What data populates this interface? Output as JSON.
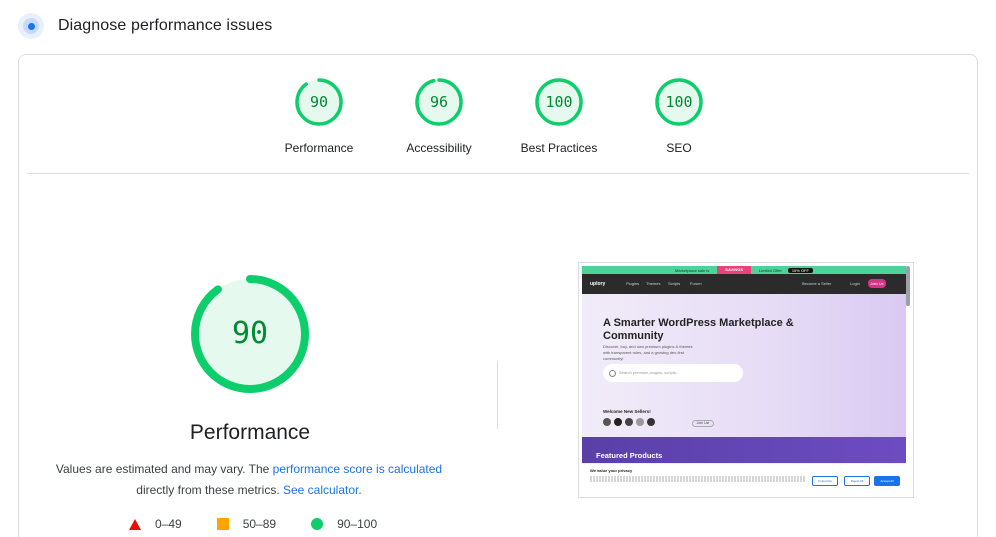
{
  "header": {
    "title": "Diagnose performance issues",
    "icon": "lighthouse-icon"
  },
  "categories": [
    {
      "score": "90",
      "label": "Performance"
    },
    {
      "score": "96",
      "label": "Accessibility"
    },
    {
      "score": "100",
      "label": "Best Practices"
    },
    {
      "score": "100",
      "label": "SEO"
    }
  ],
  "main": {
    "score": "90",
    "title": "Performance",
    "desc_part1": "Values are estimated and may vary. The ",
    "desc_link1": "performance score is calculated",
    "desc_part2": " directly from these metrics. ",
    "desc_link2": "See calculator."
  },
  "legend": [
    {
      "range": "0–49",
      "shape": "triangle",
      "color": "#eb0f00"
    },
    {
      "range": "50–89",
      "shape": "square",
      "color": "#ffa400"
    },
    {
      "range": "90–100",
      "shape": "circle",
      "color": "#0cce6b"
    }
  ],
  "colors": {
    "pass": "#0cce6b",
    "pass_text": "#008a33",
    "pass_fill": "#e6f9ee",
    "link": "#1a73e8"
  },
  "thumbnail": {
    "promo_left": "Marketplace sale is",
    "promo_badge": "SAVINGS",
    "promo_right": "Limited Offer",
    "promo_tag": "15% OFF",
    "brand": "uplory",
    "nav": [
      "Plugins",
      "Themes",
      "Scripts",
      "Forum"
    ],
    "nav_right": "Become a Seller",
    "login": "Login",
    "join": "Join Us",
    "hero_title": "A Smarter WordPress Marketplace & Community",
    "hero_sub": "Discover, buy, and own premium plugins & themes with transparent rules, and a growing dev-first community!",
    "search_placeholder": "Search premium plugins, scripts...",
    "welcome": "Welcome New Sellers!",
    "join_btn": "Join Us!",
    "featured": "Featured Products",
    "cookie_title": "We value your privacy",
    "cookie_btns": [
      "Customize",
      "Reject All",
      "Accept All"
    ]
  }
}
